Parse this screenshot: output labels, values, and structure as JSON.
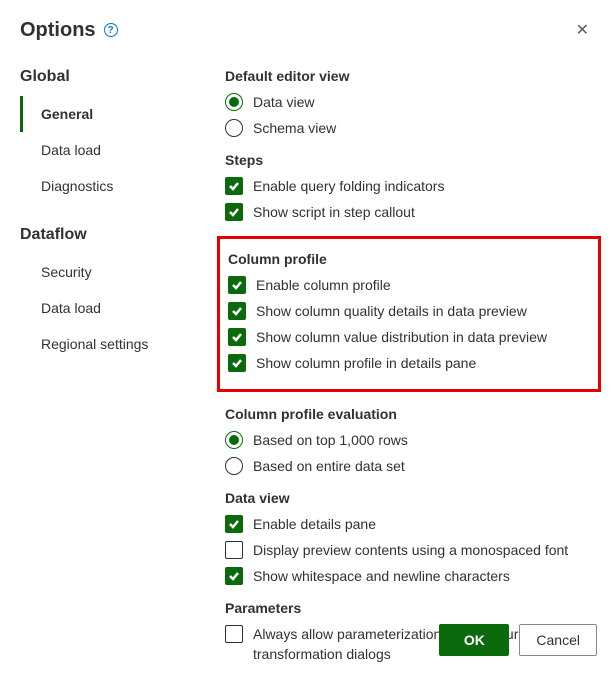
{
  "dialog": {
    "title": "Options",
    "close_label": "✕"
  },
  "sidebar": {
    "groups": [
      {
        "label": "Global",
        "items": [
          {
            "label": "General",
            "selected": true
          },
          {
            "label": "Data load",
            "selected": false
          },
          {
            "label": "Diagnostics",
            "selected": false
          }
        ]
      },
      {
        "label": "Dataflow",
        "items": [
          {
            "label": "Security",
            "selected": false
          },
          {
            "label": "Data load",
            "selected": false
          },
          {
            "label": "Regional settings",
            "selected": false
          }
        ]
      }
    ]
  },
  "sections": {
    "default_editor_view": {
      "title": "Default editor view",
      "options": [
        {
          "label": "Data view",
          "selected": true
        },
        {
          "label": "Schema view",
          "selected": false
        }
      ]
    },
    "steps": {
      "title": "Steps",
      "options": [
        {
          "label": "Enable query folding indicators",
          "checked": true
        },
        {
          "label": "Show script in step callout",
          "checked": true
        }
      ]
    },
    "column_profile": {
      "title": "Column profile",
      "highlighted": true,
      "options": [
        {
          "label": "Enable column profile",
          "checked": true
        },
        {
          "label": "Show column quality details in data preview",
          "checked": true
        },
        {
          "label": "Show column value distribution in data preview",
          "checked": true
        },
        {
          "label": "Show column profile in details pane",
          "checked": true
        }
      ]
    },
    "column_profile_eval": {
      "title": "Column profile evaluation",
      "options": [
        {
          "label": "Based on top 1,000 rows",
          "selected": true
        },
        {
          "label": "Based on entire data set",
          "selected": false
        }
      ]
    },
    "data_view": {
      "title": "Data view",
      "options": [
        {
          "label": "Enable details pane",
          "checked": true
        },
        {
          "label": "Display preview contents using a monospaced font",
          "checked": false
        },
        {
          "label": "Show whitespace and newline characters",
          "checked": true
        }
      ]
    },
    "parameters": {
      "title": "Parameters",
      "options": [
        {
          "label": "Always allow parameterization in data source and transformation dialogs",
          "checked": false
        }
      ]
    }
  },
  "footer": {
    "ok": "OK",
    "cancel": "Cancel"
  }
}
